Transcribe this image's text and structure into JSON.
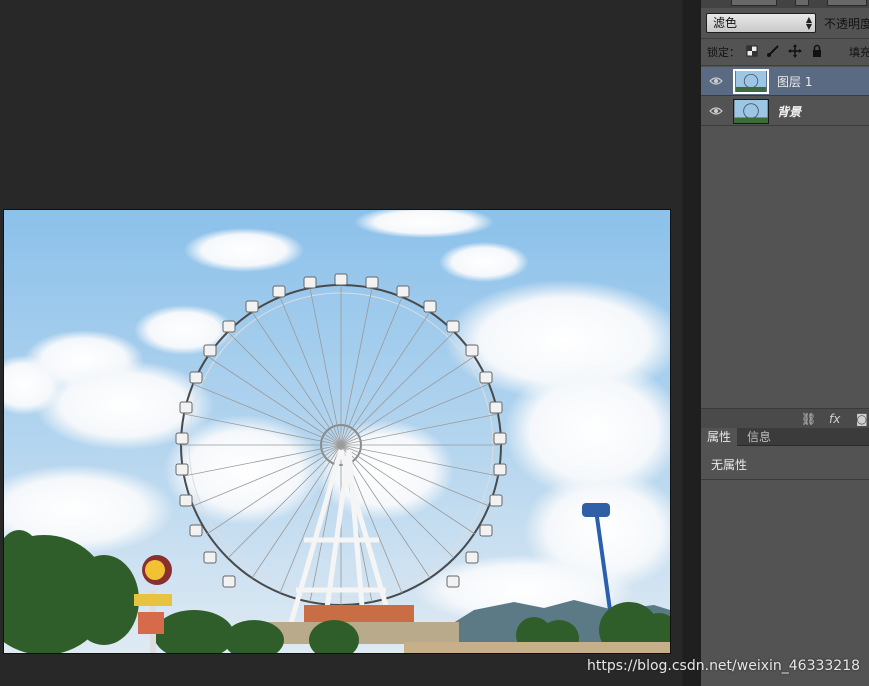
{
  "layers_panel": {
    "blend_mode": "滤色",
    "opacity_label": "不透明度",
    "lock_label": "锁定：",
    "fill_label": "填充",
    "layers": [
      {
        "name": "图层 1",
        "selected": true
      },
      {
        "name": "背景",
        "selected": false
      }
    ]
  },
  "properties_panel": {
    "tabs": [
      "属性",
      "信息"
    ],
    "active_tab": "属性",
    "body_text": "无属性"
  },
  "footer_icons": [
    "link-icon",
    "fx-icon",
    "mask-icon"
  ],
  "watermark": "https://blog.csdn.net/weixin_46333218",
  "colors": {
    "panel_bg": "#535353",
    "canvas_bg": "#282828",
    "selected_layer": "#5a6a82"
  }
}
